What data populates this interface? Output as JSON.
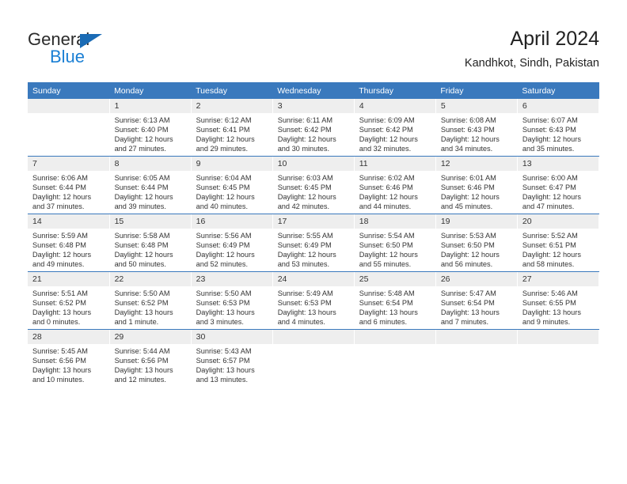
{
  "brand": {
    "name_top": "General",
    "name_bottom": "Blue",
    "triangle_color": "#1a6bb5",
    "blue_color": "#1a7fd4"
  },
  "header": {
    "title": "April 2024",
    "subtitle": "Kandhkot, Sindh, Pakistan"
  },
  "theme": {
    "header_bg": "#3a79bd",
    "header_text": "#ffffff",
    "daynum_bg": "#eeeeee",
    "text": "#333333"
  },
  "weekday_headers": [
    "Sunday",
    "Monday",
    "Tuesday",
    "Wednesday",
    "Thursday",
    "Friday",
    "Saturday"
  ],
  "weeks": [
    [
      {
        "day": "",
        "sunrise": "",
        "sunset": "",
        "daylight_1": "",
        "daylight_2": "",
        "empty": true
      },
      {
        "day": "1",
        "sunrise": "Sunrise: 6:13 AM",
        "sunset": "Sunset: 6:40 PM",
        "daylight_1": "Daylight: 12 hours",
        "daylight_2": "and 27 minutes."
      },
      {
        "day": "2",
        "sunrise": "Sunrise: 6:12 AM",
        "sunset": "Sunset: 6:41 PM",
        "daylight_1": "Daylight: 12 hours",
        "daylight_2": "and 29 minutes."
      },
      {
        "day": "3",
        "sunrise": "Sunrise: 6:11 AM",
        "sunset": "Sunset: 6:42 PM",
        "daylight_1": "Daylight: 12 hours",
        "daylight_2": "and 30 minutes."
      },
      {
        "day": "4",
        "sunrise": "Sunrise: 6:09 AM",
        "sunset": "Sunset: 6:42 PM",
        "daylight_1": "Daylight: 12 hours",
        "daylight_2": "and 32 minutes."
      },
      {
        "day": "5",
        "sunrise": "Sunrise: 6:08 AM",
        "sunset": "Sunset: 6:43 PM",
        "daylight_1": "Daylight: 12 hours",
        "daylight_2": "and 34 minutes."
      },
      {
        "day": "6",
        "sunrise": "Sunrise: 6:07 AM",
        "sunset": "Sunset: 6:43 PM",
        "daylight_1": "Daylight: 12 hours",
        "daylight_2": "and 35 minutes."
      }
    ],
    [
      {
        "day": "7",
        "sunrise": "Sunrise: 6:06 AM",
        "sunset": "Sunset: 6:44 PM",
        "daylight_1": "Daylight: 12 hours",
        "daylight_2": "and 37 minutes."
      },
      {
        "day": "8",
        "sunrise": "Sunrise: 6:05 AM",
        "sunset": "Sunset: 6:44 PM",
        "daylight_1": "Daylight: 12 hours",
        "daylight_2": "and 39 minutes."
      },
      {
        "day": "9",
        "sunrise": "Sunrise: 6:04 AM",
        "sunset": "Sunset: 6:45 PM",
        "daylight_1": "Daylight: 12 hours",
        "daylight_2": "and 40 minutes."
      },
      {
        "day": "10",
        "sunrise": "Sunrise: 6:03 AM",
        "sunset": "Sunset: 6:45 PM",
        "daylight_1": "Daylight: 12 hours",
        "daylight_2": "and 42 minutes."
      },
      {
        "day": "11",
        "sunrise": "Sunrise: 6:02 AM",
        "sunset": "Sunset: 6:46 PM",
        "daylight_1": "Daylight: 12 hours",
        "daylight_2": "and 44 minutes."
      },
      {
        "day": "12",
        "sunrise": "Sunrise: 6:01 AM",
        "sunset": "Sunset: 6:46 PM",
        "daylight_1": "Daylight: 12 hours",
        "daylight_2": "and 45 minutes."
      },
      {
        "day": "13",
        "sunrise": "Sunrise: 6:00 AM",
        "sunset": "Sunset: 6:47 PM",
        "daylight_1": "Daylight: 12 hours",
        "daylight_2": "and 47 minutes."
      }
    ],
    [
      {
        "day": "14",
        "sunrise": "Sunrise: 5:59 AM",
        "sunset": "Sunset: 6:48 PM",
        "daylight_1": "Daylight: 12 hours",
        "daylight_2": "and 49 minutes."
      },
      {
        "day": "15",
        "sunrise": "Sunrise: 5:58 AM",
        "sunset": "Sunset: 6:48 PM",
        "daylight_1": "Daylight: 12 hours",
        "daylight_2": "and 50 minutes."
      },
      {
        "day": "16",
        "sunrise": "Sunrise: 5:56 AM",
        "sunset": "Sunset: 6:49 PM",
        "daylight_1": "Daylight: 12 hours",
        "daylight_2": "and 52 minutes."
      },
      {
        "day": "17",
        "sunrise": "Sunrise: 5:55 AM",
        "sunset": "Sunset: 6:49 PM",
        "daylight_1": "Daylight: 12 hours",
        "daylight_2": "and 53 minutes."
      },
      {
        "day": "18",
        "sunrise": "Sunrise: 5:54 AM",
        "sunset": "Sunset: 6:50 PM",
        "daylight_1": "Daylight: 12 hours",
        "daylight_2": "and 55 minutes."
      },
      {
        "day": "19",
        "sunrise": "Sunrise: 5:53 AM",
        "sunset": "Sunset: 6:50 PM",
        "daylight_1": "Daylight: 12 hours",
        "daylight_2": "and 56 minutes."
      },
      {
        "day": "20",
        "sunrise": "Sunrise: 5:52 AM",
        "sunset": "Sunset: 6:51 PM",
        "daylight_1": "Daylight: 12 hours",
        "daylight_2": "and 58 minutes."
      }
    ],
    [
      {
        "day": "21",
        "sunrise": "Sunrise: 5:51 AM",
        "sunset": "Sunset: 6:52 PM",
        "daylight_1": "Daylight: 13 hours",
        "daylight_2": "and 0 minutes."
      },
      {
        "day": "22",
        "sunrise": "Sunrise: 5:50 AM",
        "sunset": "Sunset: 6:52 PM",
        "daylight_1": "Daylight: 13 hours",
        "daylight_2": "and 1 minute."
      },
      {
        "day": "23",
        "sunrise": "Sunrise: 5:50 AM",
        "sunset": "Sunset: 6:53 PM",
        "daylight_1": "Daylight: 13 hours",
        "daylight_2": "and 3 minutes."
      },
      {
        "day": "24",
        "sunrise": "Sunrise: 5:49 AM",
        "sunset": "Sunset: 6:53 PM",
        "daylight_1": "Daylight: 13 hours",
        "daylight_2": "and 4 minutes."
      },
      {
        "day": "25",
        "sunrise": "Sunrise: 5:48 AM",
        "sunset": "Sunset: 6:54 PM",
        "daylight_1": "Daylight: 13 hours",
        "daylight_2": "and 6 minutes."
      },
      {
        "day": "26",
        "sunrise": "Sunrise: 5:47 AM",
        "sunset": "Sunset: 6:54 PM",
        "daylight_1": "Daylight: 13 hours",
        "daylight_2": "and 7 minutes."
      },
      {
        "day": "27",
        "sunrise": "Sunrise: 5:46 AM",
        "sunset": "Sunset: 6:55 PM",
        "daylight_1": "Daylight: 13 hours",
        "daylight_2": "and 9 minutes."
      }
    ],
    [
      {
        "day": "28",
        "sunrise": "Sunrise: 5:45 AM",
        "sunset": "Sunset: 6:56 PM",
        "daylight_1": "Daylight: 13 hours",
        "daylight_2": "and 10 minutes."
      },
      {
        "day": "29",
        "sunrise": "Sunrise: 5:44 AM",
        "sunset": "Sunset: 6:56 PM",
        "daylight_1": "Daylight: 13 hours",
        "daylight_2": "and 12 minutes."
      },
      {
        "day": "30",
        "sunrise": "Sunrise: 5:43 AM",
        "sunset": "Sunset: 6:57 PM",
        "daylight_1": "Daylight: 13 hours",
        "daylight_2": "and 13 minutes."
      },
      {
        "day": "",
        "sunrise": "",
        "sunset": "",
        "daylight_1": "",
        "daylight_2": "",
        "empty": true
      },
      {
        "day": "",
        "sunrise": "",
        "sunset": "",
        "daylight_1": "",
        "daylight_2": "",
        "empty": true
      },
      {
        "day": "",
        "sunrise": "",
        "sunset": "",
        "daylight_1": "",
        "daylight_2": "",
        "empty": true
      },
      {
        "day": "",
        "sunrise": "",
        "sunset": "",
        "daylight_1": "",
        "daylight_2": "",
        "empty": true
      }
    ]
  ]
}
